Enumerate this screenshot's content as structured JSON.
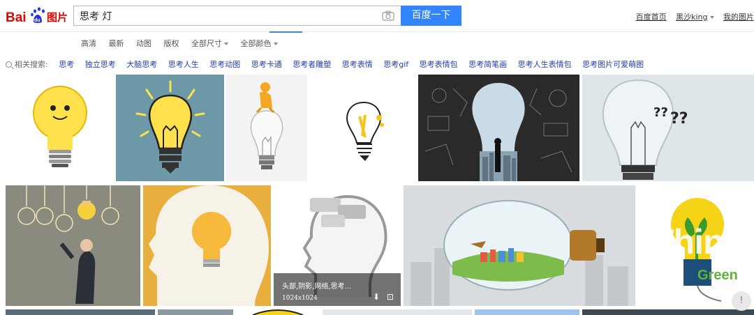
{
  "header": {
    "logo_text": "Bai du 图片",
    "query": "思考 灯",
    "search_button": "百度一下",
    "links": [
      "百度首页",
      "黑沙king",
      "我的图片"
    ]
  },
  "filters": {
    "items": [
      "高清",
      "最新",
      "动图",
      "版权",
      "全部尺寸",
      "全部颜色"
    ]
  },
  "related": {
    "label": "相关搜索:",
    "keywords": [
      "思考",
      "独立思考",
      "大脑思考",
      "思考人生",
      "思考动图",
      "思考卡通",
      "思考者雕塑",
      "思考表情",
      "思考gif",
      "思考表情包",
      "思考简笔画",
      "思考人生表情包",
      "思考图片可爱萌图"
    ]
  },
  "hover_tile": {
    "caption": "头部,阴影,网络,思考...",
    "size": "1024x1024"
  },
  "think_tile": {
    "think": "Think",
    "green": "Green"
  },
  "colors": {
    "accent": "#3385ff",
    "link": "#2440b3"
  }
}
